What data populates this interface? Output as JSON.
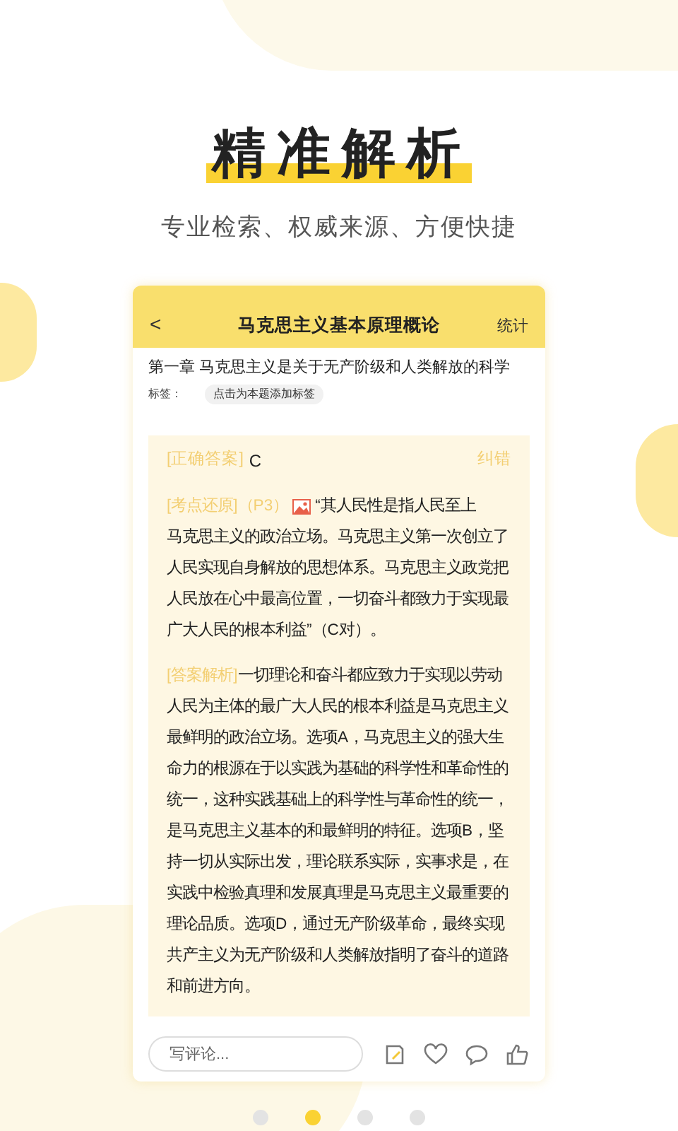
{
  "hero": {
    "title": "精准解析",
    "subtitle": "专业检索、权威来源、方便快捷"
  },
  "card": {
    "header": {
      "back": "<",
      "title": "马克思主义基本原理概论",
      "action": "统计"
    },
    "chapter": "第一章 马克思主义是关于无产阶级和人类解放的科学",
    "tags": {
      "label": "标签：",
      "button": "点击为本题添加标签"
    },
    "answer": {
      "label": "[正确答案]",
      "value": "C",
      "action": "纠错"
    },
    "source": {
      "label": "[考点还原]",
      "page": "（P3）",
      "first_line": "“其人民性是指人民至上",
      "text": "马克思主义的政治立场。马克思主义第一次创立了人民实现自身解放的思想体系。马克思主义政党把人民放在心中最高位置，一切奋斗都致力于实现最广大人民的根本利益”（C对）。"
    },
    "analysis": {
      "label": "[答案解析]",
      "text": "一切理论和奋斗都应致力于实现以劳动人民为主体的最广大人民的根本利益是马克思主义最鲜明的政治立场。选项A，马克思主义的强大生命力的根源在于以实践为基础的科学性和革命性的统一，这种实践基础上的科学性与革命性的统一，是马克思主义基本的和最鲜明的特征。选项B，坚持一切从实际出发，理论联系实际，实事求是，在实践中检验真理和发展真理是马克思主义最重要的理论品质。选项D，通过无产阶级革命，最终实现共产主义为无产阶级和人类解放指明了奋斗的道路和前进方向。"
    },
    "comment": {
      "placeholder": "写评论..."
    }
  },
  "pager": [
    {
      "selected": false
    },
    {
      "selected": true
    },
    {
      "selected": false
    },
    {
      "selected": false
    }
  ]
}
